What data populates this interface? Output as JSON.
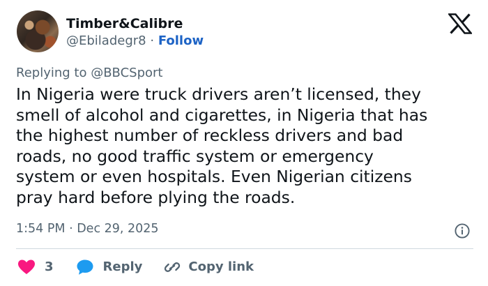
{
  "author": {
    "name": "Timber&Calibre",
    "handle": "@Ebiladegr8",
    "separator": "·",
    "follow_label": "Follow"
  },
  "reply_context": "Replying to @BBCSport",
  "tweet": {
    "lines": [
      "In Nigeria were truck drivers aren’t licensed, they",
      "smell of alcohol and cigarettes, in Nigeria that has",
      "the highest number of reckless drivers and bad",
      "roads, no good traffic system or emergency",
      "system or even hospitals. Even Nigerian citizens",
      "pray hard before plying the roads."
    ]
  },
  "timestamp": "1:54 PM · Dec 29, 2025",
  "actions": {
    "like_count": "3",
    "reply_label": "Reply",
    "copy_link_label": "Copy link"
  },
  "icons": {
    "logo": "x-logo-icon",
    "info": "info-icon",
    "like": "heart-icon",
    "reply": "speech-bubble-icon",
    "copy": "link-icon"
  },
  "colors": {
    "text": "#0f1419",
    "secondary": "#536471",
    "follow": "#1d63c5",
    "heart": "#f91880",
    "reply_bubble": "#1d9bf0",
    "divider": "#cfd9de"
  }
}
